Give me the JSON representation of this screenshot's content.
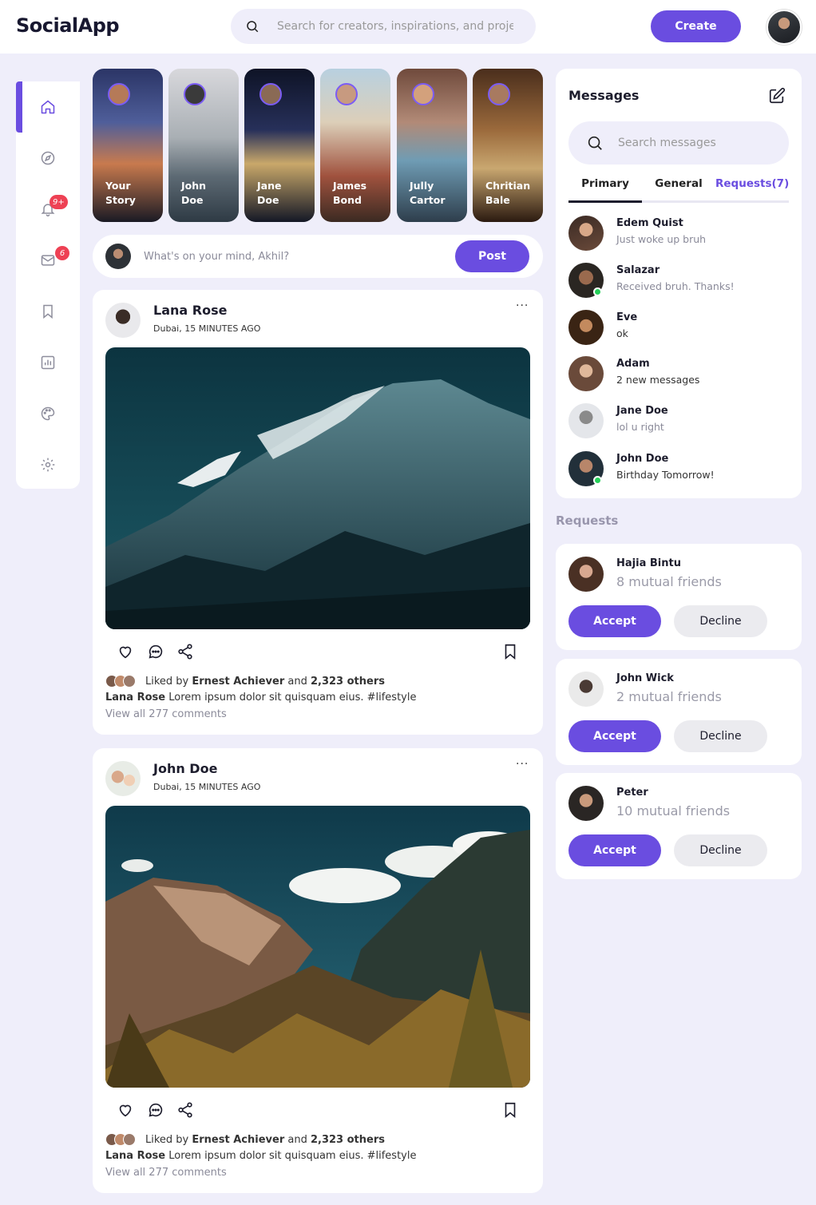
{
  "app": {
    "name": "SocialApp"
  },
  "header": {
    "search_placeholder": "Search for creators, inspirations, and projects",
    "create_label": "Create"
  },
  "sidebar": {
    "items": [
      {
        "icon": "home-icon",
        "active": true
      },
      {
        "icon": "explore-icon"
      },
      {
        "icon": "bell-icon",
        "badge": "9+"
      },
      {
        "icon": "mail-icon",
        "badge": "6"
      },
      {
        "icon": "bookmark-icon"
      },
      {
        "icon": "analytics-icon"
      },
      {
        "icon": "palette-icon"
      },
      {
        "icon": "settings-icon"
      }
    ],
    "badges": {
      "notifications": "9+",
      "messages": "6"
    }
  },
  "stories": [
    {
      "name": "Your\nStory"
    },
    {
      "name": "John\nDoe"
    },
    {
      "name": "Jane\nDoe"
    },
    {
      "name": "James\nBond"
    },
    {
      "name": "Jully\nCartor"
    },
    {
      "name": "Chritian\nBale"
    }
  ],
  "composer": {
    "placeholder": "What's on your mind, Akhil?",
    "post_label": "Post"
  },
  "posts": [
    {
      "author": "Lana Rose",
      "meta": "Dubai, 15 MINUTES AGO",
      "more": "···",
      "likes_prefix": "Liked by ",
      "likes_user": "Ernest Achiever",
      "likes_mid": " and ",
      "likes_count": "2,323 others",
      "caption_author": "Lana Rose",
      "caption_text": " Lorem ipsum dolor sit quisquam eius. #lifestyle",
      "comments": "View all 277 comments"
    },
    {
      "author": "John Doe",
      "meta": "Dubai, 15 MINUTES AGO",
      "more": "···",
      "likes_prefix": "Liked by ",
      "likes_user": "Ernest Achiever",
      "likes_mid": " and ",
      "likes_count": "2,323 others",
      "caption_author": "Lana Rose",
      "caption_text": " Lorem ipsum dolor sit quisquam eius. #lifestyle",
      "comments": "View all 277 comments"
    }
  ],
  "messages": {
    "title": "Messages",
    "search_placeholder": "Search messages",
    "tabs": [
      "Primary",
      "General",
      "Requests(7)"
    ],
    "list": [
      {
        "name": "Edem Quist",
        "text": "Just woke up bruh",
        "online": false
      },
      {
        "name": "Salazar",
        "text": "Received bruh. Thanks!",
        "online": true
      },
      {
        "name": "Eve",
        "text": "ok",
        "online": false
      },
      {
        "name": "Adam",
        "text": "2 new messages",
        "online": false
      },
      {
        "name": "Jane Doe",
        "text": "lol u right",
        "online": false
      },
      {
        "name": "John Doe",
        "text": "Birthday Tomorrow!",
        "online": true
      }
    ]
  },
  "requests": {
    "title": "Requests",
    "accept_label": "Accept",
    "decline_label": "Decline",
    "list": [
      {
        "name": "Hajia Bintu",
        "mutual": "8 mutual friends"
      },
      {
        "name": "John Wick",
        "mutual": "2 mutual friends"
      },
      {
        "name": "Peter",
        "mutual": "10 mutual friends"
      }
    ]
  },
  "colors": {
    "accent": "#6a4de0",
    "background": "#efeefa",
    "badge": "#ee4154",
    "online": "#26d05a"
  }
}
